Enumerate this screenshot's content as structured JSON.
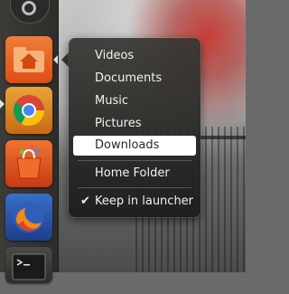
{
  "quicklist": {
    "items": [
      {
        "label": "Videos"
      },
      {
        "label": "Documents"
      },
      {
        "label": "Music"
      },
      {
        "label": "Pictures"
      },
      {
        "label": "Downloads",
        "highlighted": true
      },
      {
        "label": "Home Folder"
      },
      {
        "label": "Keep in launcher",
        "checked": true
      }
    ]
  },
  "launcher": {
    "items": [
      {
        "icon": "dash-gear-icon"
      },
      {
        "icon": "home-folder-icon"
      },
      {
        "icon": "chrome-icon"
      },
      {
        "icon": "software-center-icon"
      },
      {
        "icon": "firefox-icon"
      },
      {
        "icon": "terminal-icon"
      }
    ]
  },
  "colors": {
    "launcher_bg": "#33322e",
    "menu_bg": "#2c2c2a",
    "highlight_bg": "#ffffff",
    "menu_text": "#f2f2f2"
  }
}
